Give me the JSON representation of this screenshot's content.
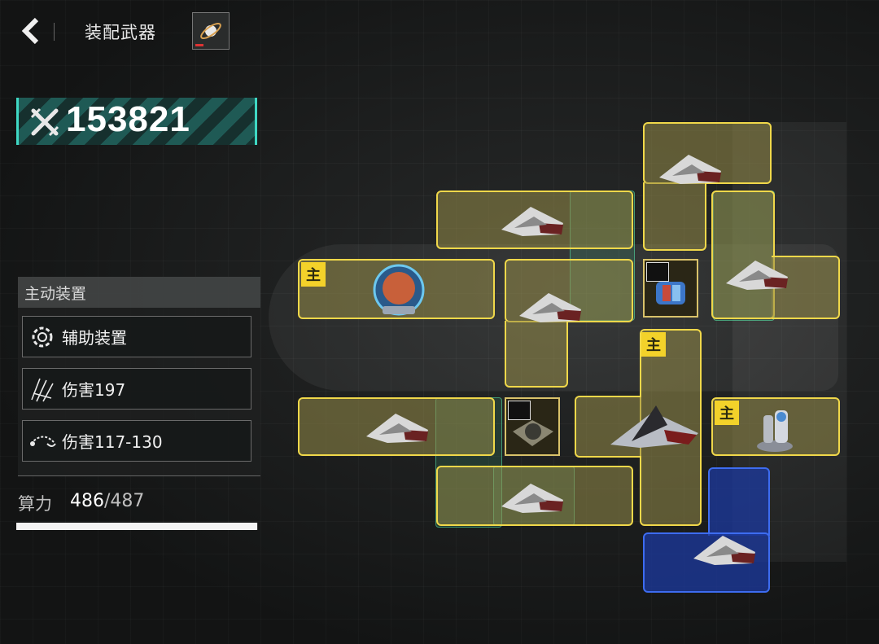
{
  "header": {
    "title": "装配武器",
    "back_icon": "chevron-left-icon",
    "skin_icon": "planet-ring-icon"
  },
  "power": {
    "icon": "crossed-swords-icon",
    "value": "153821"
  },
  "info_panel": {
    "title": "主动装置",
    "rows": [
      {
        "icon": "gear-target-icon",
        "label": "辅助装置"
      },
      {
        "icon": "claw-slash-icon",
        "label": "伤害197"
      },
      {
        "icon": "missile-arc-icon",
        "label": "伤害117-130"
      }
    ]
  },
  "compute": {
    "label": "算力",
    "used": "486",
    "total": "/487",
    "fraction": 0.998
  },
  "slots": {
    "main_tag": "主"
  },
  "colors": {
    "slot_fill": "#968c48",
    "slot_border": "#f0d84a",
    "slot_blue": "#3d6cf0",
    "accent_teal": "#3fd8c4",
    "main_tag": "#f3d22a"
  }
}
